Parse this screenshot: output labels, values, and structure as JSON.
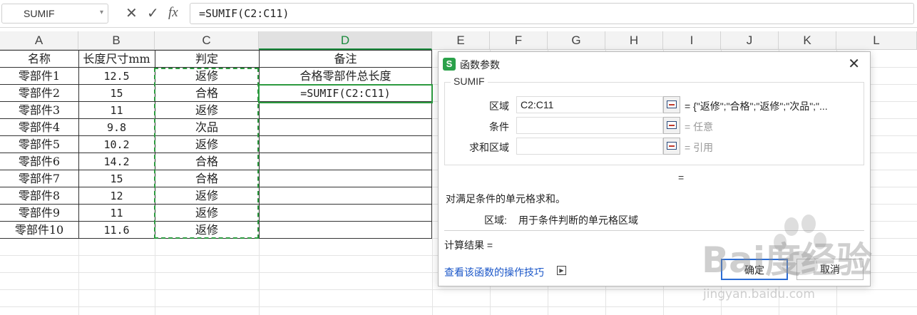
{
  "formula_bar": {
    "name_box": "SUMIF",
    "formula": "=SUMIF(C2:C11)"
  },
  "columns": [
    "A",
    "B",
    "C",
    "D",
    "E",
    "F",
    "G",
    "H",
    "I",
    "J",
    "K",
    "L"
  ],
  "table": {
    "headers": [
      "名称",
      "长度尺寸mm",
      "判定",
      "备注"
    ],
    "rows": [
      [
        "零部件1",
        "12.5",
        "返修",
        "合格零部件总长度"
      ],
      [
        "零部件2",
        "15",
        "合格",
        "=SUMIF(C2:C11)"
      ],
      [
        "零部件3",
        "11",
        "返修",
        ""
      ],
      [
        "零部件4",
        "9.8",
        "次品",
        ""
      ],
      [
        "零部件5",
        "10.2",
        "返修",
        ""
      ],
      [
        "零部件6",
        "14.2",
        "合格",
        ""
      ],
      [
        "零部件7",
        "15",
        "合格",
        ""
      ],
      [
        "零部件8",
        "12",
        "返修",
        ""
      ],
      [
        "零部件9",
        "11",
        "返修",
        ""
      ],
      [
        "零部件10",
        "11.6",
        "返修",
        ""
      ]
    ]
  },
  "dialog": {
    "icon_letter": "S",
    "title": "函数参数",
    "close": "✕",
    "function_name": "SUMIF",
    "args": [
      {
        "label": "区域",
        "value": "C2:C11",
        "result": "= {\"返修\";\"合格\";\"返修\";\"次品\";\"...",
        "muted": false
      },
      {
        "label": "条件",
        "value": "",
        "result": "= 任意",
        "muted": true
      },
      {
        "label": "求和区域",
        "value": "",
        "result": "= 引用",
        "muted": true
      }
    ],
    "equals": "=",
    "description": "对满足条件的单元格求和。",
    "arg_desc_label": "区域:",
    "arg_desc_text": "用于条件判断的单元格区域",
    "calc_result": "计算结果 =",
    "help_link": "查看该函数的操作技巧",
    "ok": "确定",
    "cancel": "取消"
  },
  "watermark": {
    "text": "Bai度经验",
    "url": "jingyan.baidu.com"
  },
  "colors": {
    "accent_green": "#2c9a3f",
    "link_blue": "#1a56c8"
  }
}
